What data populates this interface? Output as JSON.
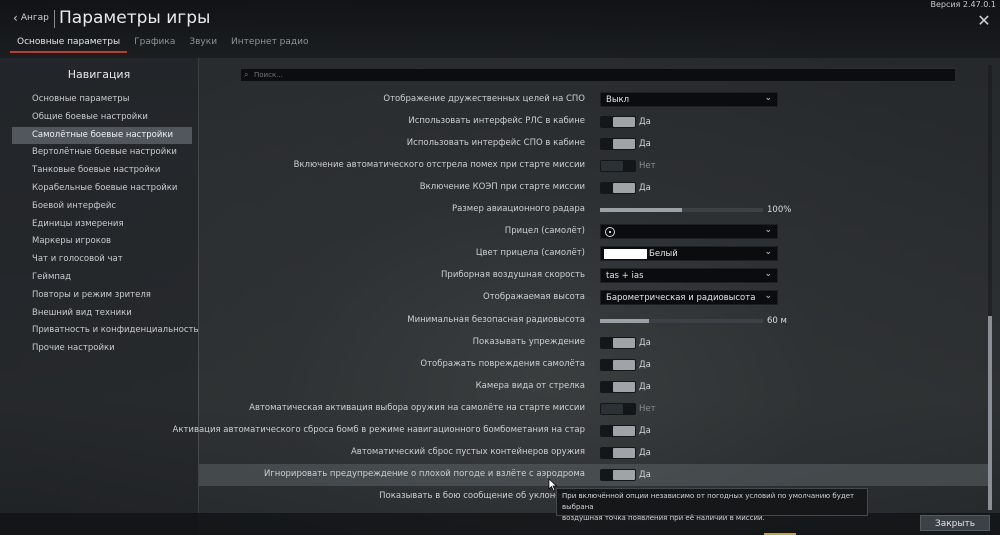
{
  "header": {
    "back_label": "Ангар",
    "title": "Параметры игры",
    "version": "Версия 2.47.0.1"
  },
  "tabs": [
    {
      "label": "Основные параметры",
      "active": true
    },
    {
      "label": "Графика",
      "active": false
    },
    {
      "label": "Звуки",
      "active": false
    },
    {
      "label": "Интернет радио",
      "active": false
    }
  ],
  "nav": {
    "title": "Навигация",
    "items": [
      {
        "label": "Основные параметры",
        "active": false
      },
      {
        "label": "Общие боевые настройки",
        "active": false
      },
      {
        "label": "Самолётные боевые настройки",
        "active": true
      },
      {
        "label": "Вертолётные боевые настройки",
        "active": false
      },
      {
        "label": "Танковые боевые настройки",
        "active": false
      },
      {
        "label": "Корабельные боевые настройки",
        "active": false
      },
      {
        "label": "Боевой интерфейс",
        "active": false
      },
      {
        "label": "Единицы измерения",
        "active": false
      },
      {
        "label": "Маркеры игроков",
        "active": false
      },
      {
        "label": "Чат и голосовой чат",
        "active": false
      },
      {
        "label": "Геймпад",
        "active": false
      },
      {
        "label": "Повторы и режим зрителя",
        "active": false
      },
      {
        "label": "Внешний вид техники",
        "active": false
      },
      {
        "label": "Приватность и конфиденциальность",
        "active": false
      },
      {
        "label": "Прочие настройки",
        "active": false
      }
    ]
  },
  "search": {
    "placeholder": "Поиск..."
  },
  "settings": [
    {
      "label": "Отображение дружественных целей на СПО",
      "type": "select",
      "value": "Выкл"
    },
    {
      "label": "Использовать интерфейс РЛС в кабине",
      "type": "toggle",
      "on": true,
      "value": "Да"
    },
    {
      "label": "Использовать интерфейс СПО в кабине",
      "type": "toggle",
      "on": true,
      "value": "Да"
    },
    {
      "label": "Включение автоматического отстрела помех при старте миссии",
      "type": "toggle",
      "on": false,
      "value": "Нет"
    },
    {
      "label": "Включение КОЭП при старте миссии",
      "type": "toggle",
      "on": true,
      "value": "Да"
    },
    {
      "label": "Размер авиационного радара",
      "type": "slider",
      "fraction": 0.5,
      "value": "100%"
    },
    {
      "label": "Прицел (самолёт)",
      "type": "select-icon",
      "value": ""
    },
    {
      "label": "Цвет прицела (самолёт)",
      "type": "select-color",
      "value": "Белый",
      "color": "#ffffff"
    },
    {
      "label": "Приборная воздушная скорость",
      "type": "select",
      "value": "tas + ias"
    },
    {
      "label": "Отображаемая высота",
      "type": "select",
      "value": "Барометрическая и радиовысота"
    },
    {
      "label": "Минимальная безопасная радиовысота",
      "type": "slider",
      "fraction": 0.3,
      "value": "60 м"
    },
    {
      "label": "Показывать упреждение",
      "type": "toggle",
      "on": true,
      "value": "Да"
    },
    {
      "label": "Отображать повреждения самолёта",
      "type": "toggle",
      "on": true,
      "value": "Да"
    },
    {
      "label": "Камера вида от стрелка",
      "type": "toggle",
      "on": true,
      "value": "Да"
    },
    {
      "label": "Автоматическая активация выбора оружия на самолёте на старте миссии",
      "type": "toggle",
      "on": false,
      "value": "Нет"
    },
    {
      "label": "Активация автоматического сброса бомб в режиме навигационного бомбометания на стар",
      "type": "toggle",
      "on": true,
      "value": "Да"
    },
    {
      "label": "Автоматический сброс пустых контейнеров оружия",
      "type": "toggle",
      "on": true,
      "value": "Да"
    },
    {
      "label": "Игнорировать предупреждение о плохой погоде и взлёте с аэродрома",
      "type": "toggle",
      "on": true,
      "value": "Да",
      "hover": true
    },
    {
      "label": "Показывать в бою сообщение об уклонении о",
      "type": "none",
      "value": ""
    }
  ],
  "tooltip": {
    "line1": "При включённой опции независимо от погодных условий по умолчанию будет выбрана",
    "line2": "воздушная точка появления при её наличии в миссии."
  },
  "footer": {
    "close_label": "Закрыть"
  },
  "colors": {
    "accent": "#c0392b",
    "active_nav": "#6e767d"
  }
}
